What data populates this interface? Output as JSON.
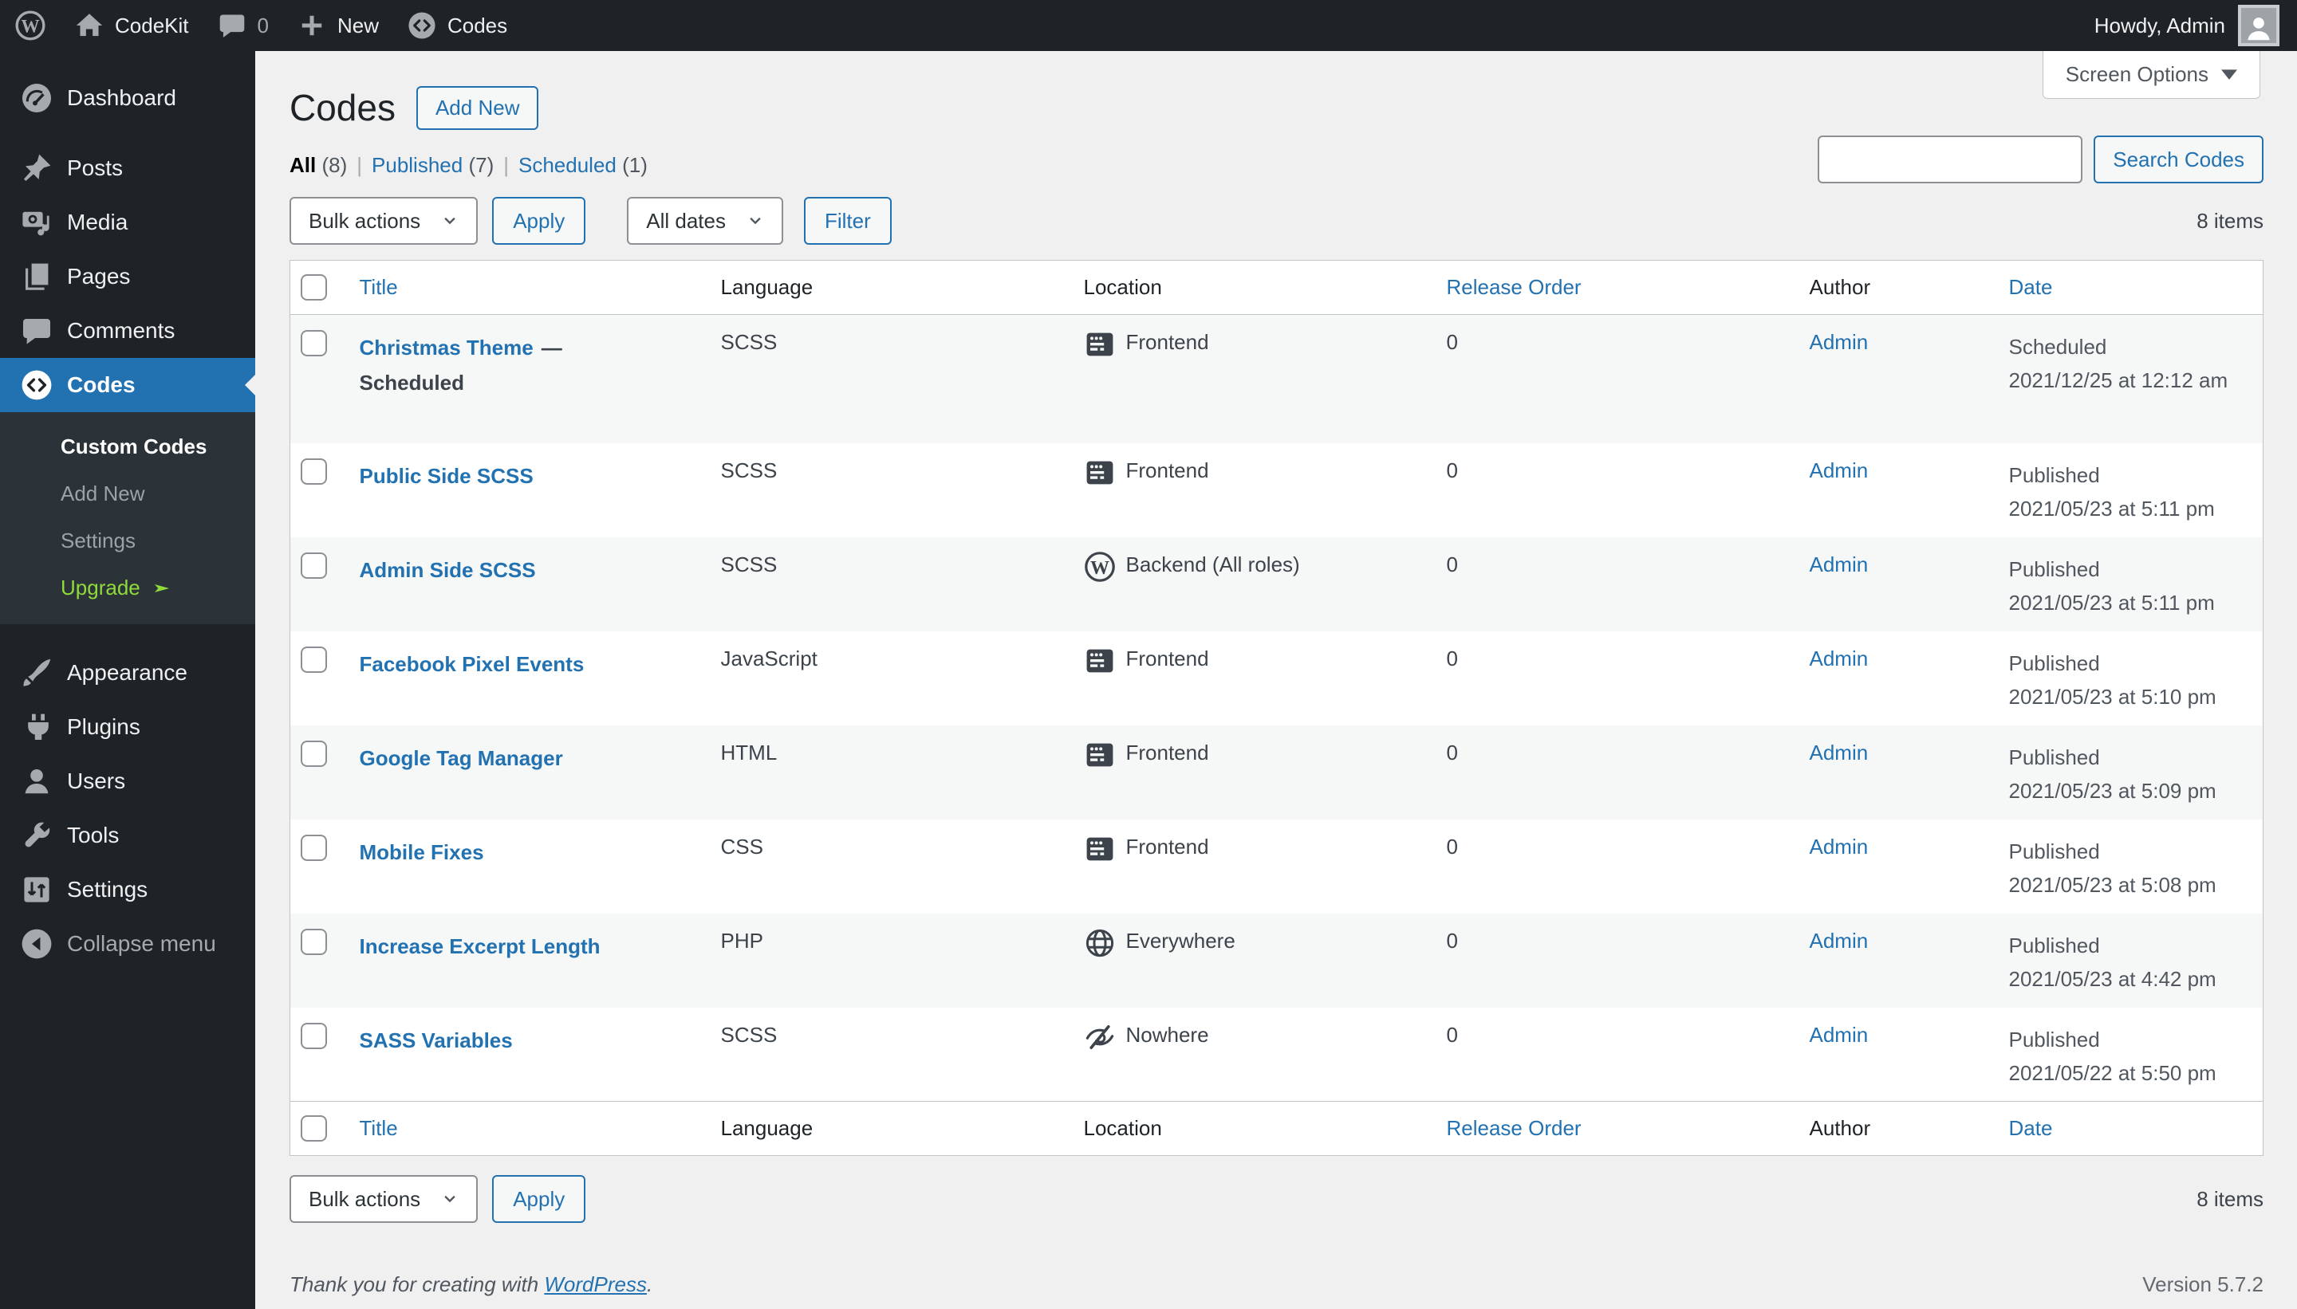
{
  "colors": {
    "accent": "#2271b1",
    "admin_bar_bg": "#1d2327",
    "submenu_bg": "#2c3338",
    "content_bg": "#f0f0f1",
    "stripe": "#f6f7f7",
    "border": "#c3c4c7",
    "text_dark": "#3c434a",
    "text_mid": "#50575e",
    "upgrade_green": "#8edb39",
    "button_bg": "#f6f7f7"
  },
  "admin_bar": {
    "site_name": "CodeKit",
    "comments_count": "0",
    "new_label": "New",
    "codes_label": "Codes",
    "howdy": "Howdy, Admin"
  },
  "sidebar": {
    "items_top": [
      {
        "label": "Dashboard",
        "icon": "dashboard-icon"
      },
      {
        "label": "Posts",
        "icon": "pin-icon",
        "gap_before": true
      },
      {
        "label": "Media",
        "icon": "media-icon"
      },
      {
        "label": "Pages",
        "icon": "pages-icon"
      },
      {
        "label": "Comments",
        "icon": "comments-icon"
      },
      {
        "label": "Codes",
        "icon": "code-circle-icon",
        "active": true
      }
    ],
    "submenu": [
      {
        "label": "Custom Codes",
        "current": true
      },
      {
        "label": "Add New"
      },
      {
        "label": "Settings"
      },
      {
        "label": "Upgrade",
        "green": true,
        "arrow": true
      }
    ],
    "items_bottom": [
      {
        "label": "Appearance",
        "icon": "appearance-icon"
      },
      {
        "label": "Plugins",
        "icon": "plugins-icon"
      },
      {
        "label": "Users",
        "icon": "users-icon"
      },
      {
        "label": "Tools",
        "icon": "tools-icon"
      },
      {
        "label": "Settings",
        "icon": "settings-icon"
      }
    ],
    "collapse_label": "Collapse menu"
  },
  "page": {
    "title": "Codes",
    "add_new": "Add New",
    "screen_options": "Screen Options",
    "search_button": "Search Codes",
    "search_value": ""
  },
  "views": [
    {
      "label": "All",
      "count": "(8)",
      "current": true
    },
    {
      "label": "Published",
      "count": "(7)"
    },
    {
      "label": "Scheduled",
      "count": "(1)"
    }
  ],
  "toolbar": {
    "bulk_actions": "Bulk actions",
    "apply": "Apply",
    "dates": "All dates",
    "filter": "Filter",
    "items_count": "8 items"
  },
  "table": {
    "columns": [
      {
        "label": "Title",
        "sortable": true
      },
      {
        "label": "Language",
        "sortable": false
      },
      {
        "label": "Location",
        "sortable": false
      },
      {
        "label": "Release Order",
        "sortable": true
      },
      {
        "label": "Author",
        "sortable": false
      },
      {
        "label": "Date",
        "sortable": true
      }
    ],
    "rows": [
      {
        "title": "Christmas Theme",
        "state": "— Scheduled",
        "language": "SCSS",
        "location": "Frontend",
        "location_icon": "frontend-icon",
        "release_order": "0",
        "author": "Admin",
        "date_status": "Scheduled",
        "date": "2021/12/25 at 12:12 am"
      },
      {
        "title": "Public Side SCSS",
        "state": "",
        "language": "SCSS",
        "location": "Frontend",
        "location_icon": "frontend-icon",
        "release_order": "0",
        "author": "Admin",
        "date_status": "Published",
        "date": "2021/05/23 at 5:11 pm"
      },
      {
        "title": "Admin Side SCSS",
        "state": "",
        "language": "SCSS",
        "location": "Backend (All roles)",
        "location_icon": "backend-icon",
        "release_order": "0",
        "author": "Admin",
        "date_status": "Published",
        "date": "2021/05/23 at 5:11 pm"
      },
      {
        "title": "Facebook Pixel Events",
        "state": "",
        "language": "JavaScript",
        "location": "Frontend",
        "location_icon": "frontend-icon",
        "release_order": "0",
        "author": "Admin",
        "date_status": "Published",
        "date": "2021/05/23 at 5:10 pm"
      },
      {
        "title": "Google Tag Manager",
        "state": "",
        "language": "HTML",
        "location": "Frontend",
        "location_icon": "frontend-icon",
        "release_order": "0",
        "author": "Admin",
        "date_status": "Published",
        "date": "2021/05/23 at 5:09 pm"
      },
      {
        "title": "Mobile Fixes",
        "state": "",
        "language": "CSS",
        "location": "Frontend",
        "location_icon": "frontend-icon",
        "release_order": "0",
        "author": "Admin",
        "date_status": "Published",
        "date": "2021/05/23 at 5:08 pm"
      },
      {
        "title": "Increase Excerpt Length",
        "state": "",
        "language": "PHP",
        "location": "Everywhere",
        "location_icon": "everywhere-icon",
        "release_order": "0",
        "author": "Admin",
        "date_status": "Published",
        "date": "2021/05/23 at 4:42 pm"
      },
      {
        "title": "SASS Variables",
        "state": "",
        "language": "SCSS",
        "location": "Nowhere",
        "location_icon": "nowhere-icon",
        "release_order": "0",
        "author": "Admin",
        "date_status": "Published",
        "date": "2021/05/22 at 5:50 pm"
      }
    ]
  },
  "footer": {
    "thanks": "Thank you for creating with",
    "wordpress": "WordPress",
    "period": ".",
    "version": "Version 5.7.2"
  }
}
